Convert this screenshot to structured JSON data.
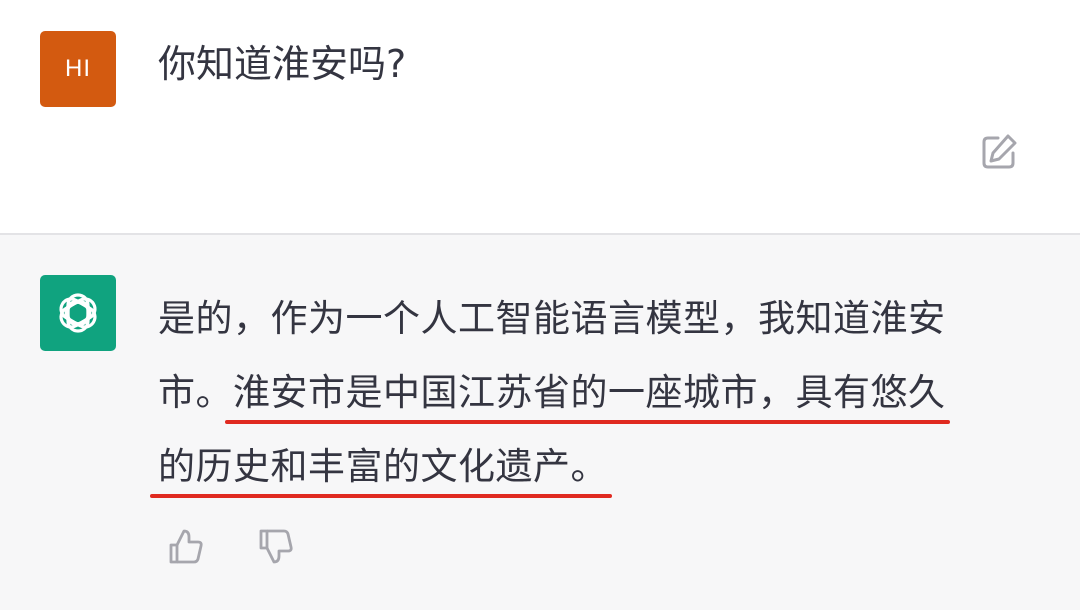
{
  "user_message": {
    "avatar_initials": "HI",
    "text": "你知道淮安吗?",
    "avatar_color": "#d35a10",
    "edit_icon": "edit-icon"
  },
  "assistant_message": {
    "avatar_icon": "openai-logo-icon",
    "avatar_color": "#10a37f",
    "lines": [
      [
        "是的，作为一个人工智能语言模型，我知道淮安"
      ],
      [
        "市。",
        "淮安市是中国江苏省的一座城市，具有悠久"
      ],
      [
        "的历史和丰富的文化遗产。"
      ]
    ],
    "highlight_color": "#e02a20",
    "feedback": {
      "thumbs_up_icon": "thumbs-up-icon",
      "thumbs_down_icon": "thumbs-down-icon"
    }
  }
}
